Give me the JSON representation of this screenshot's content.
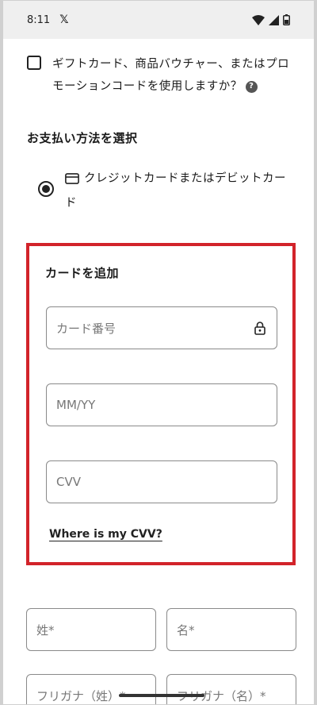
{
  "status_bar": {
    "time": "8:11",
    "app_icon": "x-logo"
  },
  "gift": {
    "text": "ギフトカード、商品バウチャー、またはプロモーションコードを使用しますか？",
    "help_label": "?"
  },
  "payment": {
    "heading": "お支払い方法を選択",
    "option_label": "クレジットカードまたはデビットカード"
  },
  "add_card": {
    "title": "カードを追加",
    "card_number_placeholder": "カード番号",
    "expiry_placeholder": "MM/YY",
    "cvv_placeholder": "CVV",
    "cvv_help_link": "Where is my CVV?"
  },
  "name": {
    "last_name_placeholder": "姓*",
    "first_name_placeholder": "名*",
    "last_name_kana_placeholder": "フリガナ（姓）*",
    "first_name_kana_placeholder": "フリガナ（名）*"
  },
  "colors": {
    "highlight": "#d2232a",
    "status_bar_bg": "#efefef"
  }
}
